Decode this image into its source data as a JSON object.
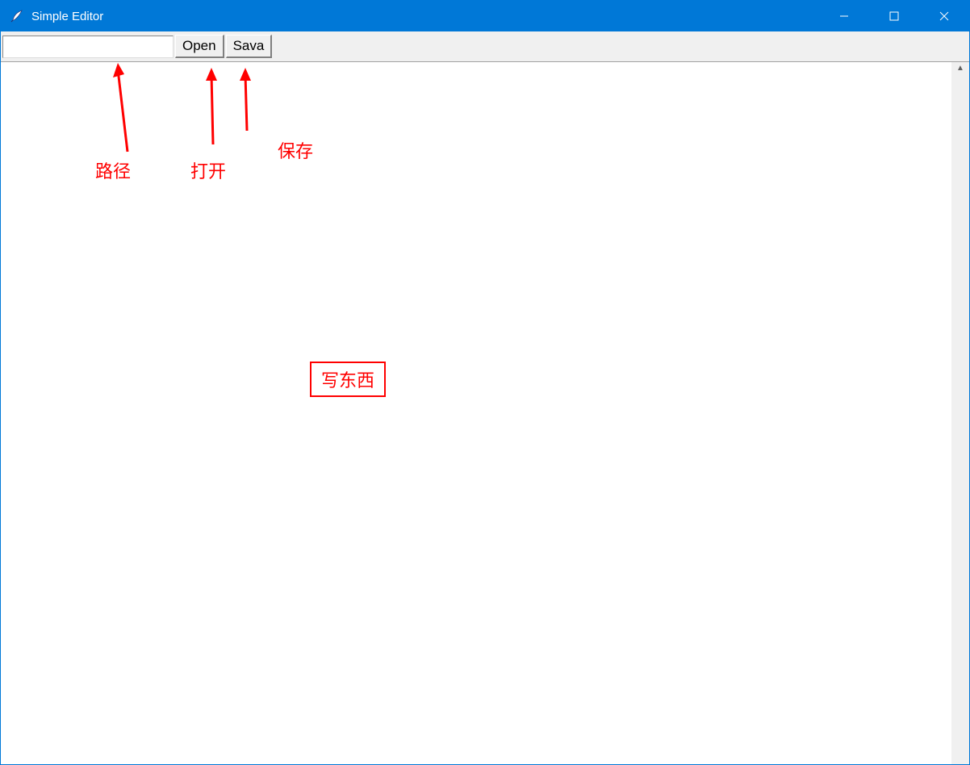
{
  "titlebar": {
    "title": "Simple Editor"
  },
  "toolbar": {
    "path_value": "",
    "open_label": "Open",
    "save_label": "Sava"
  },
  "annotations": {
    "path_label": "路径",
    "open_label": "打开",
    "save_label": "保存",
    "write_label": "写东西"
  }
}
